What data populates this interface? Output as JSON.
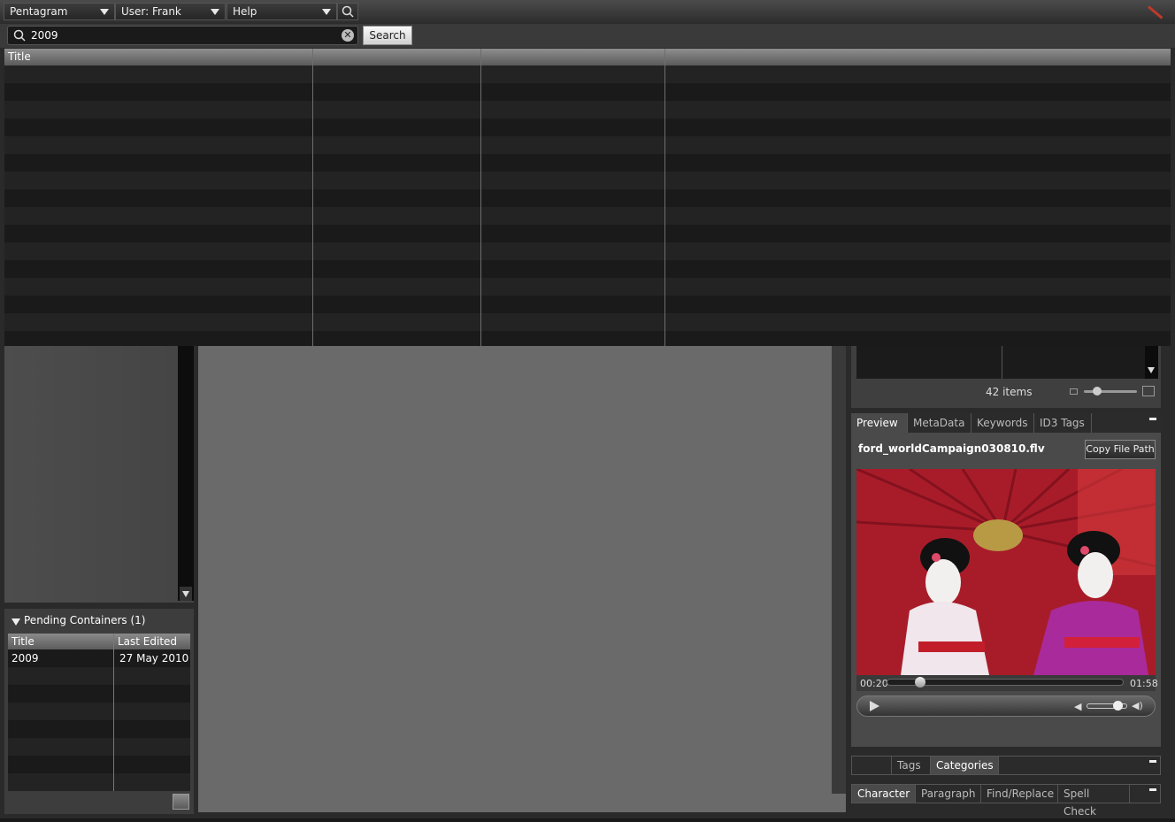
{
  "menubar": {
    "workspace": "Pentagram",
    "user": "User: Frank",
    "help": "Help"
  },
  "search": {
    "value": "2009",
    "button_label": "Search"
  },
  "results": {
    "columns": [
      "Title",
      "",
      "",
      ""
    ]
  },
  "pending": {
    "title": "Pending Containers (1)",
    "columns": [
      "Title",
      "Last Edited"
    ],
    "rows": [
      {
        "title": "2009",
        "last_edited": "27 May 2010"
      }
    ]
  },
  "browser": {
    "item_count": "42 items"
  },
  "preview": {
    "tabs": [
      "Preview",
      "MetaData",
      "Keywords",
      "ID3 Tags"
    ],
    "active_tab": "Preview",
    "filename": "ford_worldCampaign030810.flv",
    "copy_button": "Copy File Path",
    "time_current": "00:20",
    "time_total": "01:58",
    "progress": 0.14,
    "volume": 0.75
  },
  "tags_panel": {
    "tabs": [
      "Tags",
      "Categories"
    ],
    "active_tab": "Categories"
  },
  "text_panel": {
    "tabs": [
      "Character",
      "Paragraph",
      "Find/Replace",
      "Spell Check"
    ],
    "active_tab": "Character"
  }
}
